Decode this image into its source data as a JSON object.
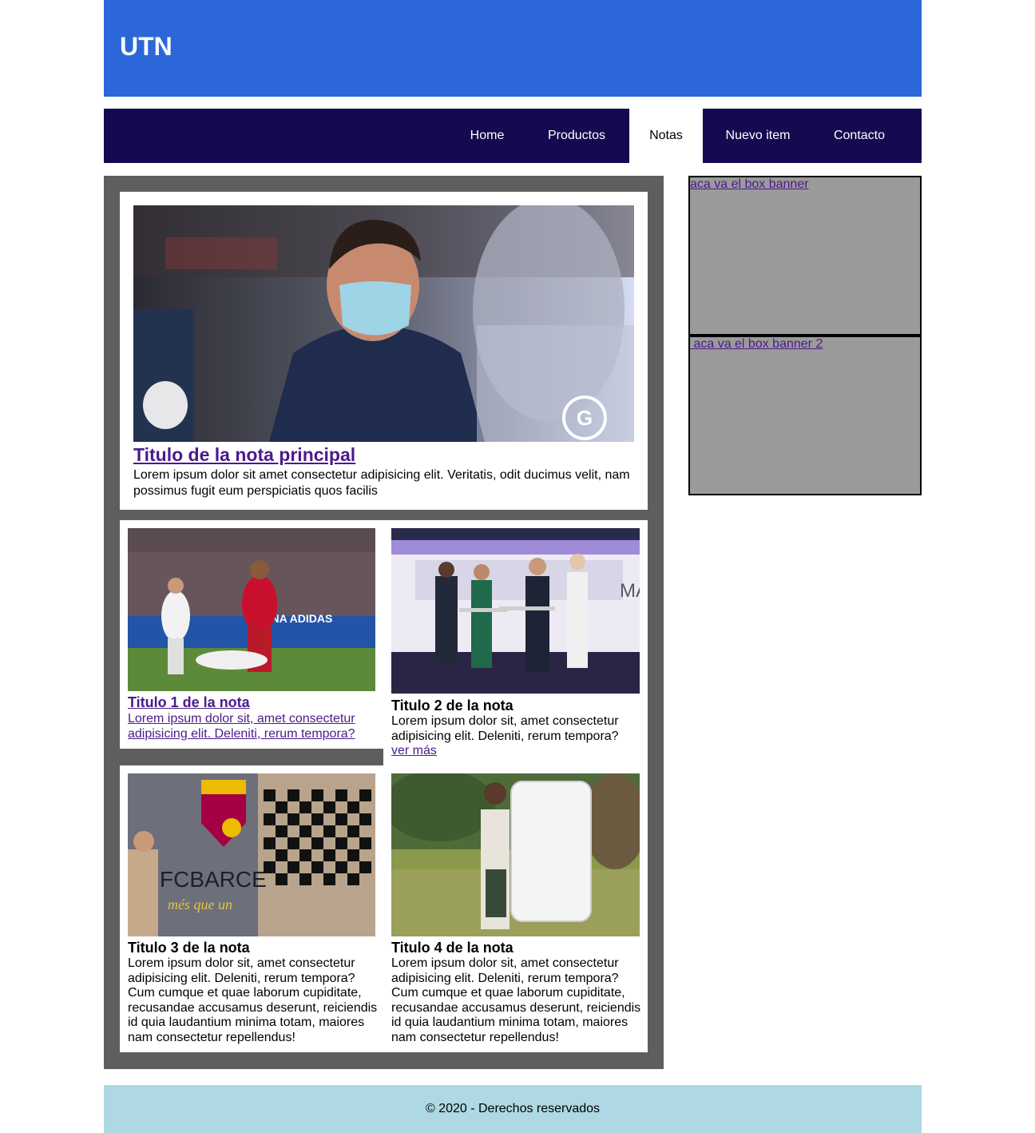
{
  "header": {
    "brand": "UTN",
    "color": "#2b67d8"
  },
  "nav": {
    "color": "#140a50",
    "items": [
      {
        "label": "Home",
        "active": false
      },
      {
        "label": "Productos",
        "active": false
      },
      {
        "label": "Notas",
        "active": true
      },
      {
        "label": "Nuevo item",
        "active": false
      },
      {
        "label": "Contacto",
        "active": false
      }
    ]
  },
  "main_article": {
    "title": "Titulo de la nota principal",
    "body": "Lorem ipsum dolor sit amet consectetur adipisicing elit. Veritatis, odit ducimus velit, nam possimus fugit eum perspiciatis quos facilis"
  },
  "articles": [
    {
      "title": "Titulo 1 de la nota",
      "body": "Lorem ipsum dolor sit, amet consectetur adipisicing elit. Deleniti, rerum tempora?"
    },
    {
      "title": "Titulo 2 de la nota",
      "body": "Lorem ipsum dolor sit, amet consectetur adipisicing elit. Deleniti, rerum tempora?",
      "more": "ver más"
    },
    {
      "title": "Titulo 3 de la nota",
      "body": "Lorem ipsum dolor sit, amet consectetur adipisicing elit. Deleniti, rerum tempora? Cum cumque et quae laborum cupiditate, recusandae accusamus deserunt, reiciendis id quia laudantium minima totam, maiores nam consectetur repellendus!"
    },
    {
      "title": "Titulo 4 de la nota",
      "body": "Lorem ipsum dolor sit, amet consectetur adipisicing elit. Deleniti, rerum tempora? Cum cumque et quae laborum cupiditate, recusandae accusamus deserunt, reiciendis id quia laudantium minima totam, maiores nam consectetur repellendus!"
    }
  ],
  "banners": [
    {
      "label": "aca va el box banner"
    },
    {
      "label": " aca va el box banner 2"
    }
  ],
  "footer": {
    "text": "© 2020 - Derechos reservados"
  },
  "photo_logo_text": {
    "badge": "G",
    "jersey_text": "FCBARCE",
    "jersey_motto": "més que un",
    "board_text": "ARENA ADIDAS",
    "bus_text": "MA"
  }
}
